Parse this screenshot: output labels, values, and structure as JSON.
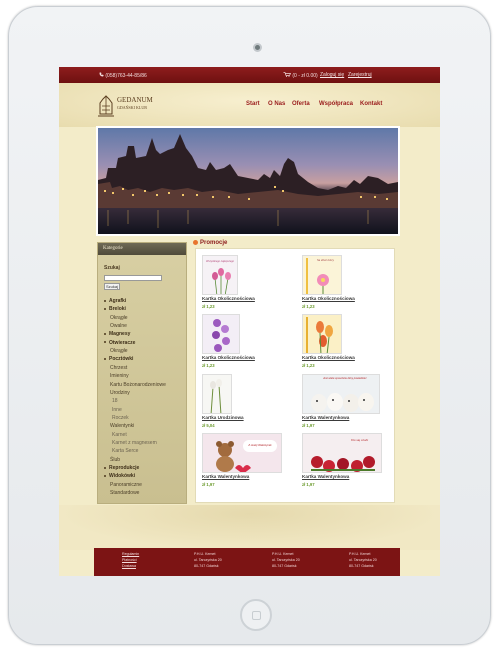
{
  "topbar": {
    "phone": "(058)763-44-85/86",
    "cart": "(0 - zł 0.00)",
    "login": "Zaloguj się",
    "register": "Zarejestruj"
  },
  "logo": {
    "name": "GEDANUM",
    "subtitle": "GDAŃSKI KLUB"
  },
  "nav": [
    "Start",
    "O Nas",
    "Oferta",
    "Współpraca",
    "Kontakt"
  ],
  "sidebar": {
    "title": "Kategorie",
    "search_label": "Szukaj",
    "search_placeholder": "",
    "search_button": "Szukaj",
    "categories": [
      {
        "label": "Agrafki",
        "level": 0
      },
      {
        "label": "Breloki",
        "level": 0
      },
      {
        "label": "Okrągłe",
        "level": 1
      },
      {
        "label": "Owalne",
        "level": 1
      },
      {
        "label": "Magnesy",
        "level": 0
      },
      {
        "label": "Otwieracze",
        "level": 0
      },
      {
        "label": "Okrągłe",
        "level": 1
      },
      {
        "label": "Pocztówki",
        "level": 0
      },
      {
        "label": "Chrzest",
        "level": 1
      },
      {
        "label": "Imieniny",
        "level": 1
      },
      {
        "label": "Kartu Bożonarodzeniowe",
        "level": 1
      },
      {
        "label": "Urodziny",
        "level": 1
      },
      {
        "label": "18",
        "level": 2
      },
      {
        "label": "Inne",
        "level": 2
      },
      {
        "label": "Roczek",
        "level": 2
      },
      {
        "label": "Walentynki",
        "level": 1
      },
      {
        "label": "Karnet",
        "level": 2
      },
      {
        "label": "Karnet z magnesem",
        "level": 2
      },
      {
        "label": "Karta Serce",
        "level": 2
      },
      {
        "label": "Ślub",
        "level": 1
      },
      {
        "label": "Reprodukcje",
        "level": 0
      },
      {
        "label": "Widokówki",
        "level": 0
      },
      {
        "label": "Panoramiczne",
        "level": 1
      },
      {
        "label": "Standardowe",
        "level": 1
      }
    ]
  },
  "main": {
    "title": "Promocje",
    "products": [
      {
        "name": "Kartka Okolicznościowa",
        "price": "zł 1,23",
        "image": "pink-tulips-card",
        "thumb_text": "Wszystkiego najlepszego"
      },
      {
        "name": "Kartka Okolicznościowa",
        "price": "zł 1,23",
        "image": "pink-flower-card",
        "thumb_text": "Na dzień dobry"
      },
      {
        "name": "Kartka Okolicznościowa",
        "price": "zł 1,23",
        "image": "purple-orchid-card",
        "thumb_text": ""
      },
      {
        "name": "Kartka Okolicznościowa",
        "price": "zł 1,23",
        "image": "tulips-card",
        "thumb_text": ""
      },
      {
        "name": "Kartka Urodzinowa",
        "price": "zł 5,04",
        "image": "birthday-card",
        "thumb_text": ""
      },
      {
        "name": "Kartka Walentynkowa",
        "price": "zł 1,97",
        "image": "puppies-card",
        "thumb_text": "Jest wiele sposobów żeby powiedzieć"
      },
      {
        "name": "Kartka Walentynkowa",
        "price": "zł 1,97",
        "image": "teddy-bear-card",
        "thumb_text": "Z okazji Walentynek"
      },
      {
        "name": "Kartka Walentynkowa",
        "price": "zł 1,97",
        "image": "red-roses-card",
        "thumb_text": "Kto się czubi"
      }
    ]
  },
  "footer": {
    "links": [
      "Regulamin",
      "Płatności",
      "Dostawa"
    ],
    "columns": [
      [
        "P.H.U. Kemet",
        "ul. Tarczyńska 20",
        "80-747 Gdańsk"
      ],
      [
        "P.H.U. Kemet",
        "ul. Tarczyńska 20",
        "80-747 Gdańsk"
      ],
      [
        "P.H.U. Kemet",
        "ul. Tarczyńska 20",
        "80-747 Gdańsk"
      ]
    ]
  },
  "colors": {
    "brand_red": "#8e1d1d",
    "background": "#f3ecc9",
    "price_green": "#6a9a2c",
    "sidebar": "#d8cfa3"
  },
  "icons": [
    "phone-icon",
    "cart-icon",
    "camera-icon",
    "home-button-icon",
    "logo-crest-icon",
    "promo-dot-icon",
    "category-bullet-icon"
  ]
}
